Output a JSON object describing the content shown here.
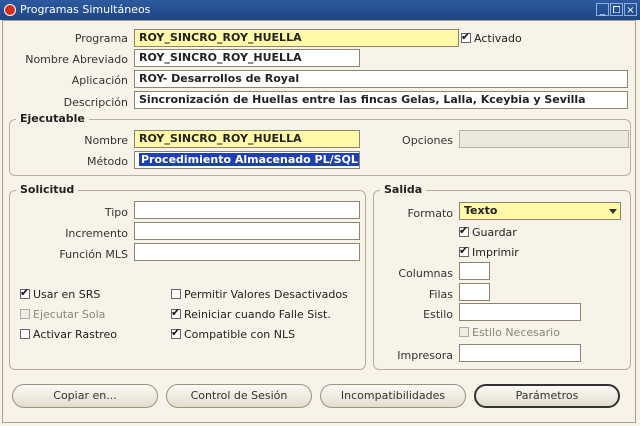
{
  "window": {
    "title": "Programas Simultáneos"
  },
  "header": {
    "programa_label": "Programa",
    "programa_value": "ROY_SINCRO_ROY_HUELLA",
    "activado_label": "Activado",
    "activado_checked": true,
    "nombre_abreviado_label": "Nombre Abreviado",
    "nombre_abreviado_value": "ROY_SINCRO_ROY_HUELLA",
    "aplicacion_label": "Aplicación",
    "aplicacion_value": "ROY- Desarrollos de Royal",
    "descripcion_label": "Descripción",
    "descripcion_value": "Sincronización de Huellas entre las fincas Gelas, Lalla, Kceybia y Sevilla"
  },
  "ejecutable": {
    "title": "Ejecutable",
    "nombre_label": "Nombre",
    "nombre_value": "ROY_SINCRO_ROY_HUELLA",
    "opciones_label": "Opciones",
    "opciones_value": "",
    "metodo_label": "Método",
    "metodo_value": "Procedimiento Almacenado PL/SQL"
  },
  "solicitud": {
    "title": "Solicitud",
    "tipo_label": "Tipo",
    "tipo_value": "",
    "incremento_label": "Incremento",
    "incremento_value": "",
    "funcion_mls_label": "Función MLS",
    "funcion_mls_value": "",
    "usar_srs": "Usar en SRS",
    "ejecutar_sola": "Ejecutar Sola",
    "activar_rastreo": "Activar Rastreo",
    "permitir_valores": "Permitir Valores Desactivados",
    "reiniciar": "Reiniciar cuando Falle Sist.",
    "compatible_nls": "Compatible con NLS"
  },
  "salida": {
    "title": "Salida",
    "formato_label": "Formato",
    "formato_value": "Texto",
    "guardar": "Guardar",
    "imprimir": "Imprimir",
    "columnas_label": "Columnas",
    "columnas_value": "",
    "filas_label": "Filas",
    "filas_value": "",
    "estilo_label": "Estilo",
    "estilo_value": "",
    "estilo_necesario": "Estilo Necesario",
    "impresora_label": "Impresora",
    "impresora_value": ""
  },
  "buttons": {
    "copiar": "Copiar en...",
    "control_sesion": "Control de Sesión",
    "incompatibilidades": "Incompatibilidades",
    "parametros": "Parámetros"
  }
}
